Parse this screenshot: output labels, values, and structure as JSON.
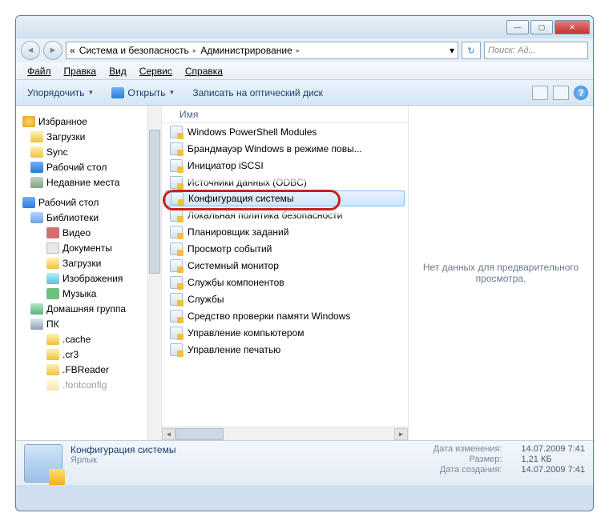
{
  "titlebar": {
    "min": "—",
    "max": "▢",
    "close": "✕"
  },
  "addr": {
    "back": "◄",
    "fwd": "►",
    "sep": "▸",
    "crumb1": "Система и безопасность",
    "crumb2": "Администрирование",
    "dropdown": "▾",
    "refresh": "↻",
    "search_placeholder": "Поиск: Ад..."
  },
  "menubar": [
    "Файл",
    "Правка",
    "Вид",
    "Сервис",
    "Справка"
  ],
  "toolbar": {
    "organize": "Упорядочить",
    "open": "Открыть",
    "burn": "Записать на оптический диск",
    "help": "?"
  },
  "sidebar": {
    "fav": "Избранное",
    "fav_items": [
      "Загрузки",
      "Sync",
      "Рабочий стол",
      "Недавние места"
    ],
    "desk": "Рабочий стол",
    "lib": "Библиотеки",
    "lib_items": [
      "Видео",
      "Документы",
      "Загрузки",
      "Изображения",
      "Музыка"
    ],
    "hg": "Домашняя группа",
    "pc": "ПК",
    "pc_items": [
      ".cache",
      ".cr3",
      ".FBReader",
      ".fontconfig"
    ]
  },
  "list": {
    "column": "Имя",
    "items": [
      "Windows PowerShell Modules",
      "Брандмауэр Windows в режиме повы...",
      "Инициатор iSCSI",
      "Источники данных (ODBC)",
      "Конфигурация системы",
      "Локальная политика безопасности",
      "Планировщик заданий",
      "Просмотр событий",
      "Системный монитор",
      "Службы компонентов",
      "Службы",
      "Средство проверки памяти Windows",
      "Управление компьютером",
      "Управление печатью"
    ],
    "selected_index": 4
  },
  "preview": {
    "text": "Нет данных для предварительного просмотра."
  },
  "details": {
    "title": "Конфигурация системы",
    "subtitle": "Ярлык",
    "modified_label": "Дата изменения:",
    "modified": "14.07.2009 7:41",
    "size_label": "Размер:",
    "size": "1,21 КБ",
    "created_label": "Дата создания:",
    "created": "14.07.2009 7:41"
  }
}
